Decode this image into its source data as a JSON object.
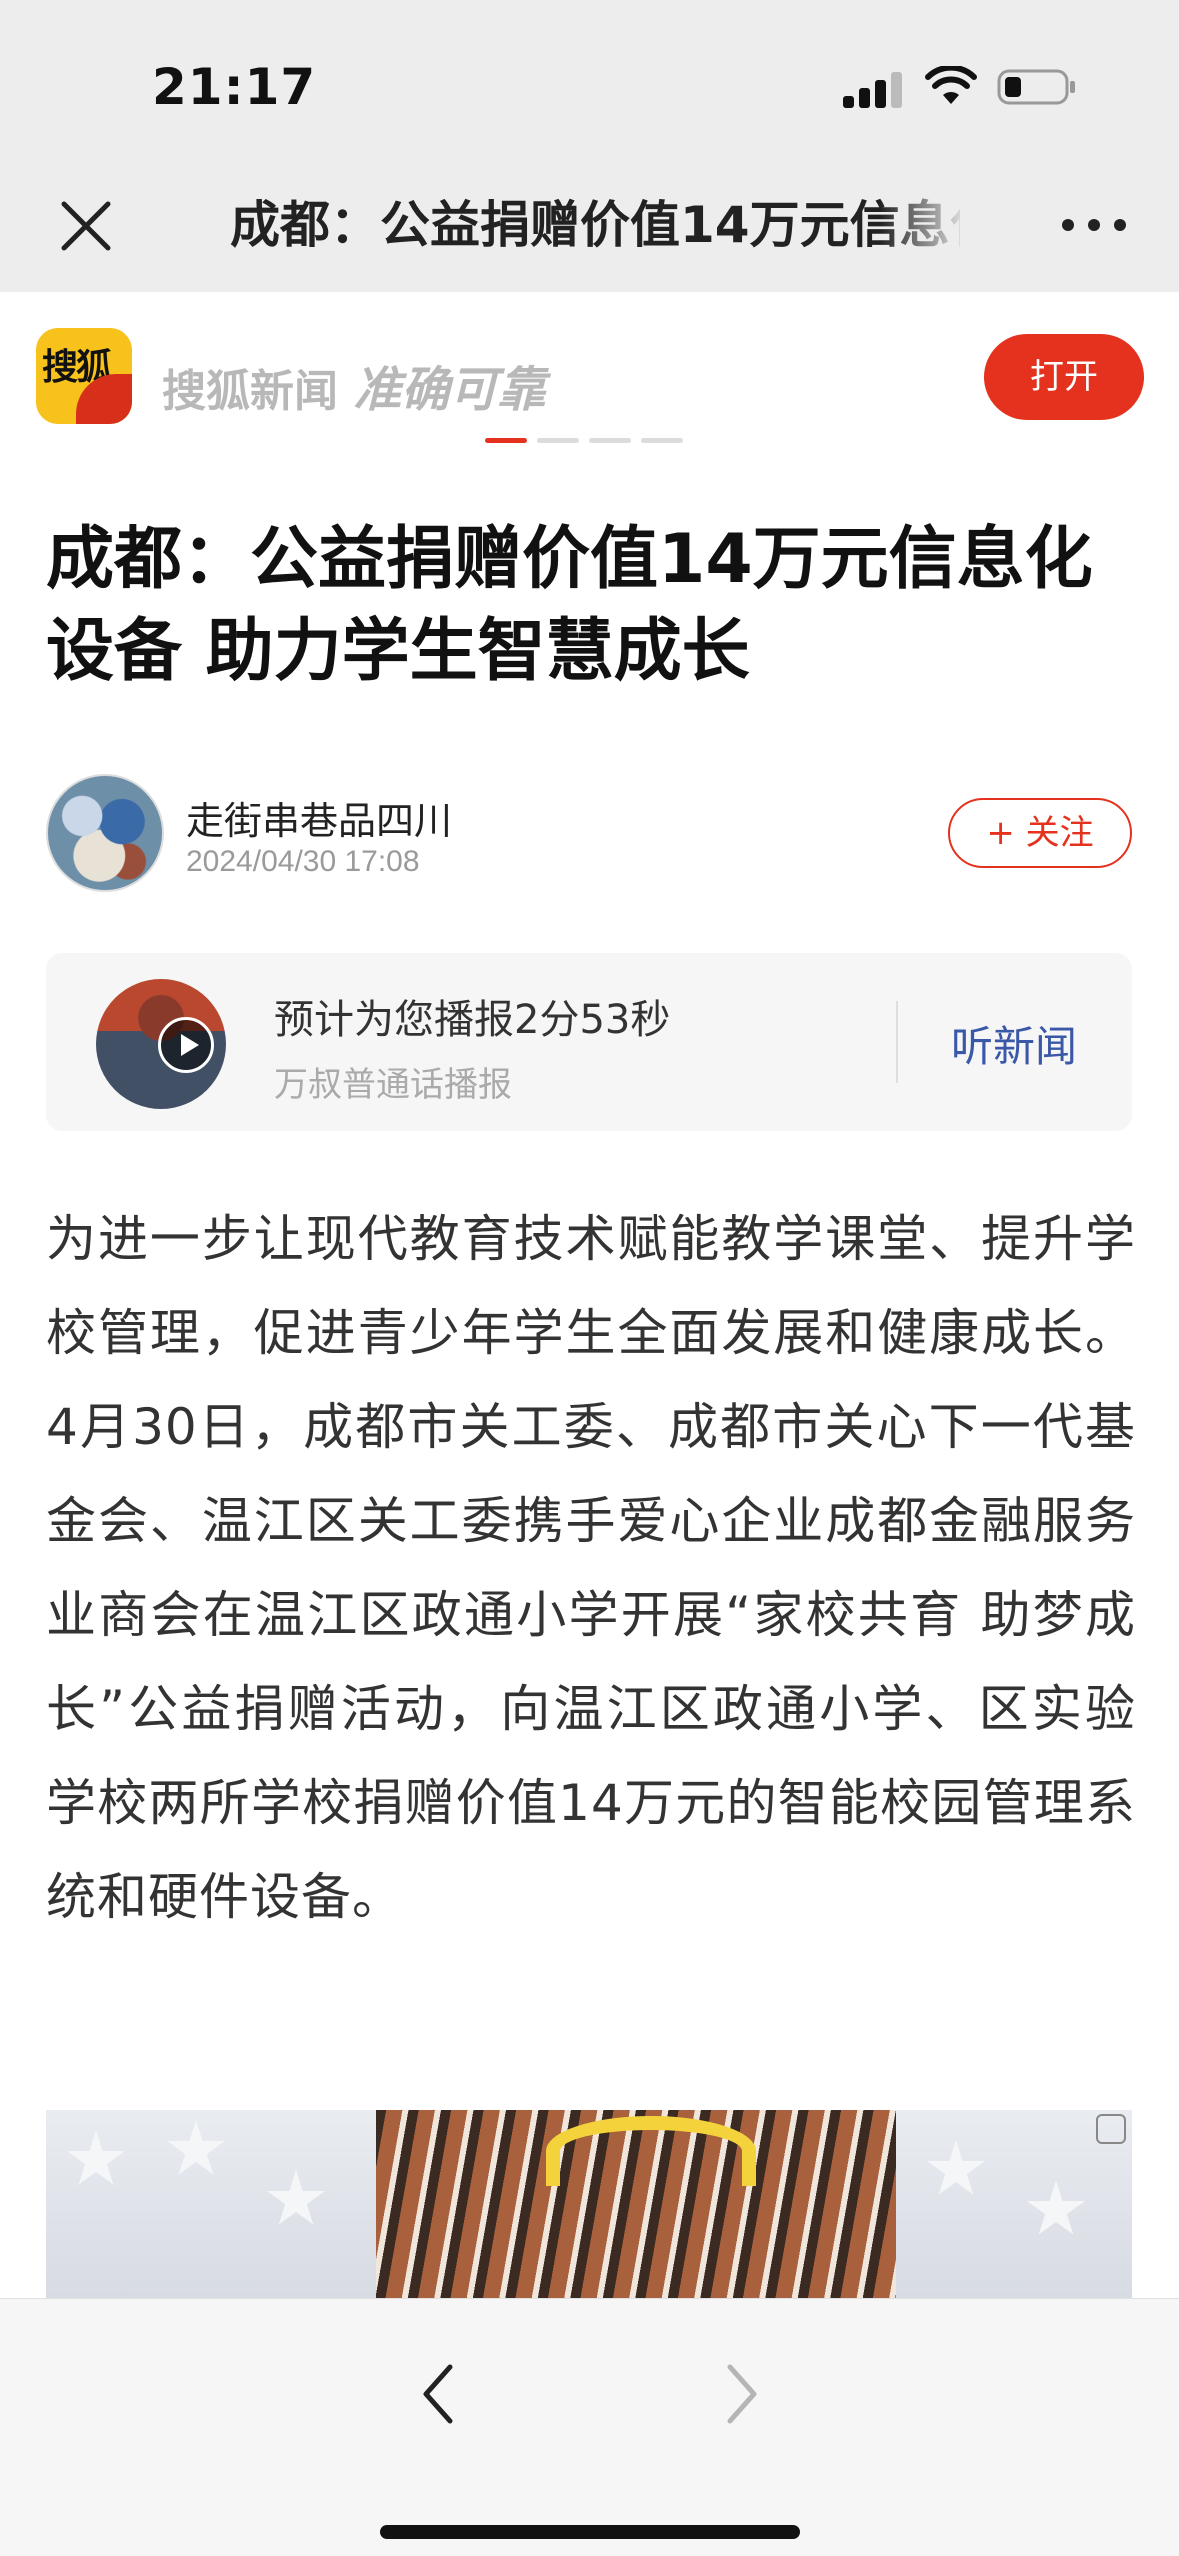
{
  "status_bar": {
    "time": "21:17",
    "icons": [
      "cellular-signal-icon",
      "wifi-icon",
      "battery-icon"
    ]
  },
  "nav": {
    "title": "成都：公益捐赠价值14万元信息化设备 助力学生智慧成长",
    "close_icon": "close-icon",
    "more_icon": "more-icon"
  },
  "app_banner": {
    "logo_text": "搜狐",
    "slogan": "搜狐新闻",
    "slogan_tagline": "准确可靠",
    "open_label": "打开",
    "accent_color": "#e4321f",
    "carousel_pages": 4,
    "carousel_active": 1
  },
  "article": {
    "headline": "成都：公益捐赠价值14万元信息化设备 助力学生智慧成长",
    "author": {
      "name": "走街串巷品四川",
      "published": "2024/04/30 17:08",
      "follow_label": "+ 关注"
    },
    "audio": {
      "title": "预计为您播报2分53秒",
      "voice": "万叔普通话播报",
      "action_label": "听新闻"
    },
    "body": "为进一步让现代教育技术赋能教学课堂、提升学校管理，促进青少年学生全面发展和健康成长。4月30日，成都市关工委、成都市关心下一代基金会、温江区关工委携手爱心企业成都金融服务业商会在温江区政通小学开展“家校共育 助梦成长”公益捐赠活动，向温江区政通小学、区实验学校两所学校捐赠价值14万元的智能校园管理系统和硬件设备。"
  },
  "toolbar": {
    "back_icon": "chevron-left-icon",
    "forward_icon": "chevron-right-icon",
    "forward_enabled": false
  }
}
